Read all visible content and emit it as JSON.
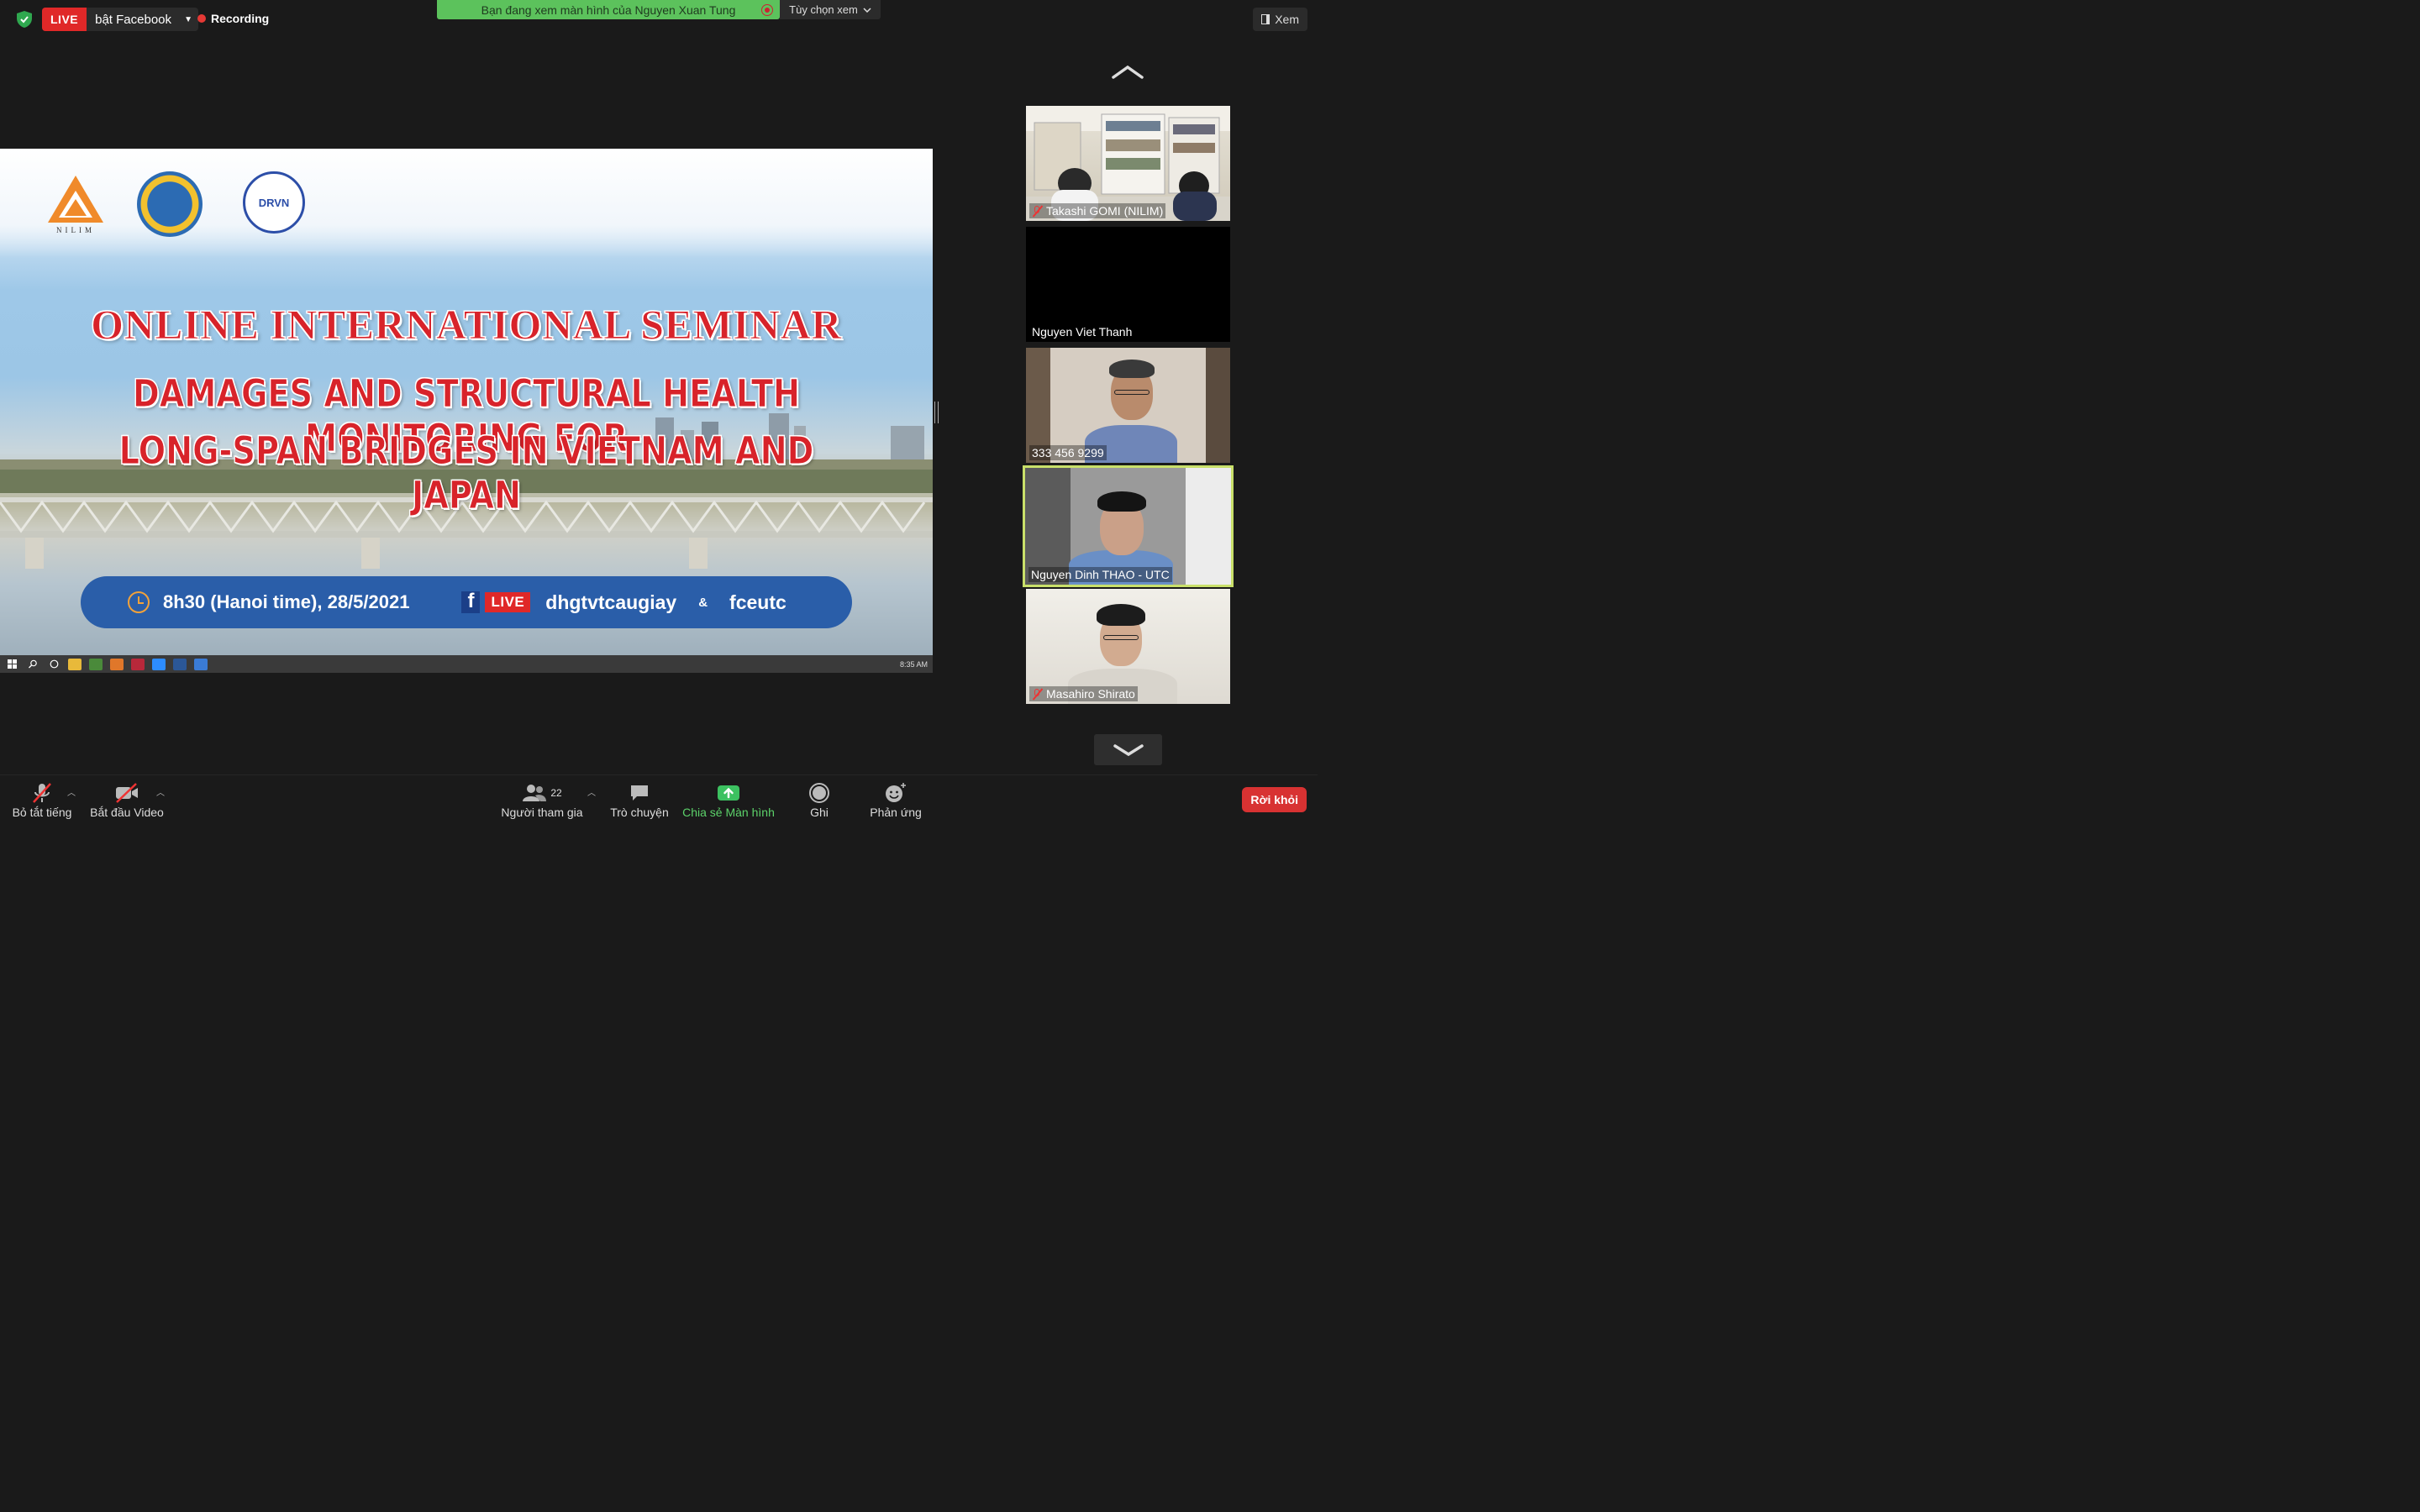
{
  "top_bar": {
    "live_badge": "LIVE",
    "live_target": "bật Facebook",
    "recording_label": "Recording",
    "share_banner": "Bạn đang xem màn hình của Nguyen Xuan Tung",
    "view_options": "Tùy chọn xem",
    "view_button": "Xem"
  },
  "shared_screen": {
    "logo_nilim_text": "NILIM",
    "logo_drvn_text": "DRVN",
    "title_line1": "ONLINE INTERNATIONAL SEMINAR",
    "title_line2": "DAMAGES AND STRUCTURAL HEALTH MONITORING FOR",
    "title_line3": "LONG-SPAN BRIDGES  IN VIETNAM AND JAPAN",
    "time": "8h30 (Hanoi time), 28/5/2021",
    "fb_live": "LIVE",
    "page1": "dhgtvtcaugiay",
    "ampersand": "&",
    "page2": "fceutc",
    "taskbar_clock": "8:35 AM"
  },
  "participants": [
    {
      "name": "Takashi GOMI  (NILIM)",
      "muted": true
    },
    {
      "name": "Nguyen Viet Thanh",
      "muted": false
    },
    {
      "name": "333 456 9299",
      "muted": false
    },
    {
      "name": "Nguyen Dinh THAO - UTC",
      "muted": false,
      "active_speaker": true
    },
    {
      "name": "Masahiro Shirato",
      "muted": true
    }
  ],
  "toolbar": {
    "mute_label": "Bỏ tắt tiếng",
    "video_label": "Bắt đầu Video",
    "participants_label": "Người tham gia",
    "participants_count": "22",
    "chat_label": "Trò chuyện",
    "share_label": "Chia sẻ Màn hình",
    "record_label": "Ghi",
    "reactions_label": "Phản ứng",
    "leave_label": "Rời khỏi"
  },
  "colors": {
    "accent_green": "#5cc25c",
    "live_red": "#e02828",
    "active_speaker_border": "#c9e06a",
    "leave_red": "#d83232",
    "title_red": "#d8232a",
    "info_bar_blue": "#2a5ea9"
  }
}
